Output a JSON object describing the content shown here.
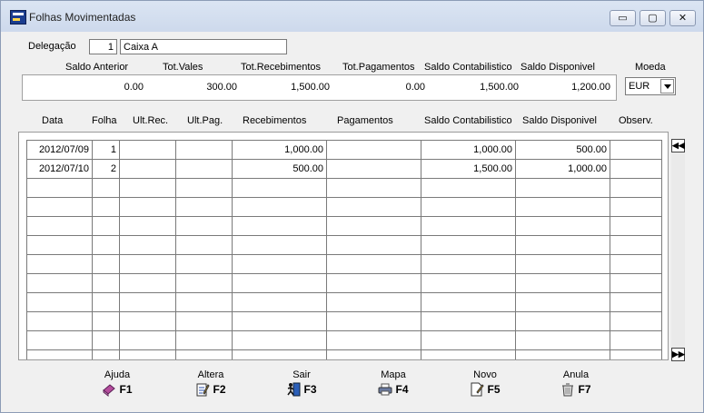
{
  "window": {
    "title": "Folhas Movimentadas",
    "min_label": "▭",
    "max_label": "▢",
    "close_label": "✕"
  },
  "delegacao": {
    "label": "Delegação",
    "code": "1",
    "name": "Caixa A"
  },
  "summary": {
    "labels": [
      "Saldo Anterior",
      "Tot.Vales",
      "Tot.Recebimentos",
      "Tot.Pagamentos",
      "Saldo Contabilistico",
      "Saldo Disponivel"
    ],
    "values": [
      "0.00",
      "300.00",
      "1,500.00",
      "0.00",
      "1,500.00",
      "1,200.00"
    ]
  },
  "moeda": {
    "label": "Moeda",
    "value": "EUR"
  },
  "grid": {
    "headers": [
      "Data",
      "Folha",
      "Ult.Rec.",
      "Ult.Pag.",
      "Recebimentos",
      "Pagamentos",
      "Saldo Contabilistico",
      "Saldo Disponivel",
      "Observ."
    ],
    "rows": [
      [
        "2012/07/09",
        "1",
        "",
        "",
        "1,000.00",
        "",
        "1,000.00",
        "500.00",
        ""
      ],
      [
        "2012/07/10",
        "2",
        "",
        "",
        "500.00",
        "",
        "1,500.00",
        "1,000.00",
        ""
      ]
    ],
    "empty_rows": 10
  },
  "scroll": {
    "up": "◀◀",
    "down": "▶▶"
  },
  "fkeys": [
    {
      "name": "Ajuda",
      "key": "F1",
      "icon": "help-book-icon",
      "color": "#b44c9c"
    },
    {
      "name": "Altera",
      "key": "F2",
      "icon": "edit-document-icon",
      "color": "#2a4fa8"
    },
    {
      "name": "Sair",
      "key": "F3",
      "icon": "exit-door-icon",
      "color": "#2b5fb8"
    },
    {
      "name": "Mapa",
      "key": "F4",
      "icon": "printer-icon",
      "color": "#6a7aa0"
    },
    {
      "name": "Novo",
      "key": "F5",
      "icon": "new-document-icon",
      "color": "#d8a020"
    },
    {
      "name": "Anula",
      "key": "F7",
      "icon": "trash-can-icon",
      "color": "#8a8a8a"
    }
  ]
}
